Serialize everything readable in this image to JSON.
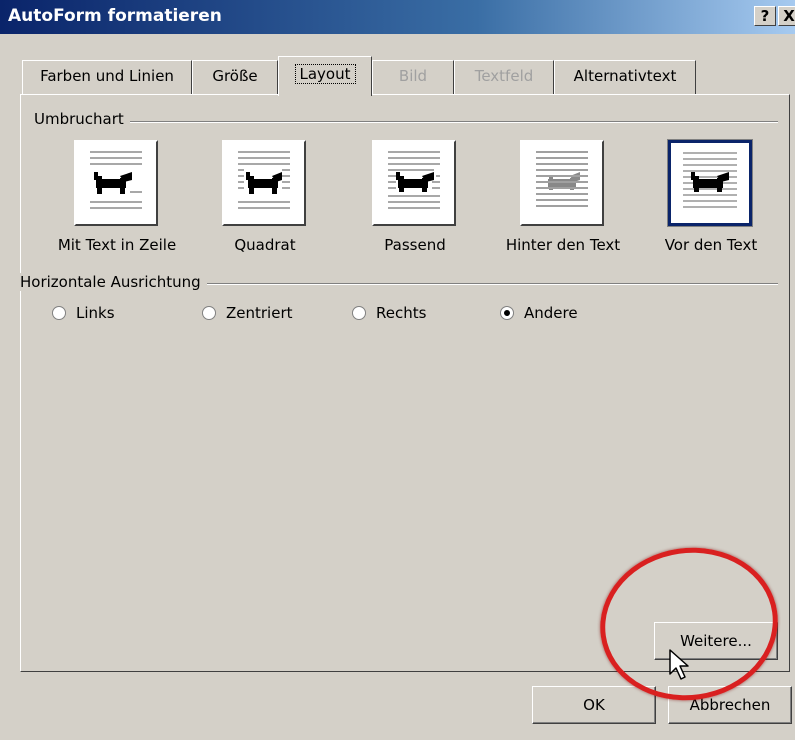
{
  "window": {
    "title": "AutoForm formatieren",
    "help_label": "?",
    "close_label": "X"
  },
  "tabs": [
    {
      "label": "Farben und Linien",
      "state": "normal"
    },
    {
      "label": "Größe",
      "state": "normal"
    },
    {
      "label": "Layout",
      "state": "active"
    },
    {
      "label": "Bild",
      "state": "disabled"
    },
    {
      "label": "Textfeld",
      "state": "disabled"
    },
    {
      "label": "Alternativtext",
      "state": "normal"
    }
  ],
  "wrap_group": {
    "label": "Umbruchart",
    "options": [
      {
        "label": "Mit Text in Zeile",
        "icon": "inline-dog-icon"
      },
      {
        "label": "Quadrat",
        "icon": "square-dog-icon"
      },
      {
        "label": "Passend",
        "icon": "tight-dog-icon"
      },
      {
        "label": "Hinter den Text",
        "icon": "behind-text-dog-icon"
      },
      {
        "label": "Vor den Text",
        "icon": "in-front-dog-icon",
        "selected": true
      }
    ]
  },
  "align_group": {
    "label": "Horizontale Ausrichtung",
    "options": [
      {
        "label": "Links",
        "checked": false
      },
      {
        "label": "Zentriert",
        "checked": false
      },
      {
        "label": "Rechts",
        "checked": false
      },
      {
        "label": "Andere",
        "checked": true
      }
    ]
  },
  "buttons": {
    "more_label": "Weitere...",
    "ok_label": "OK",
    "cancel_label": "Abbrechen"
  },
  "colors": {
    "dialog_bg": "#d4d0c8",
    "title_start": "#0a246a",
    "title_end": "#a6caf0",
    "highlight_circle": "#d92020"
  }
}
